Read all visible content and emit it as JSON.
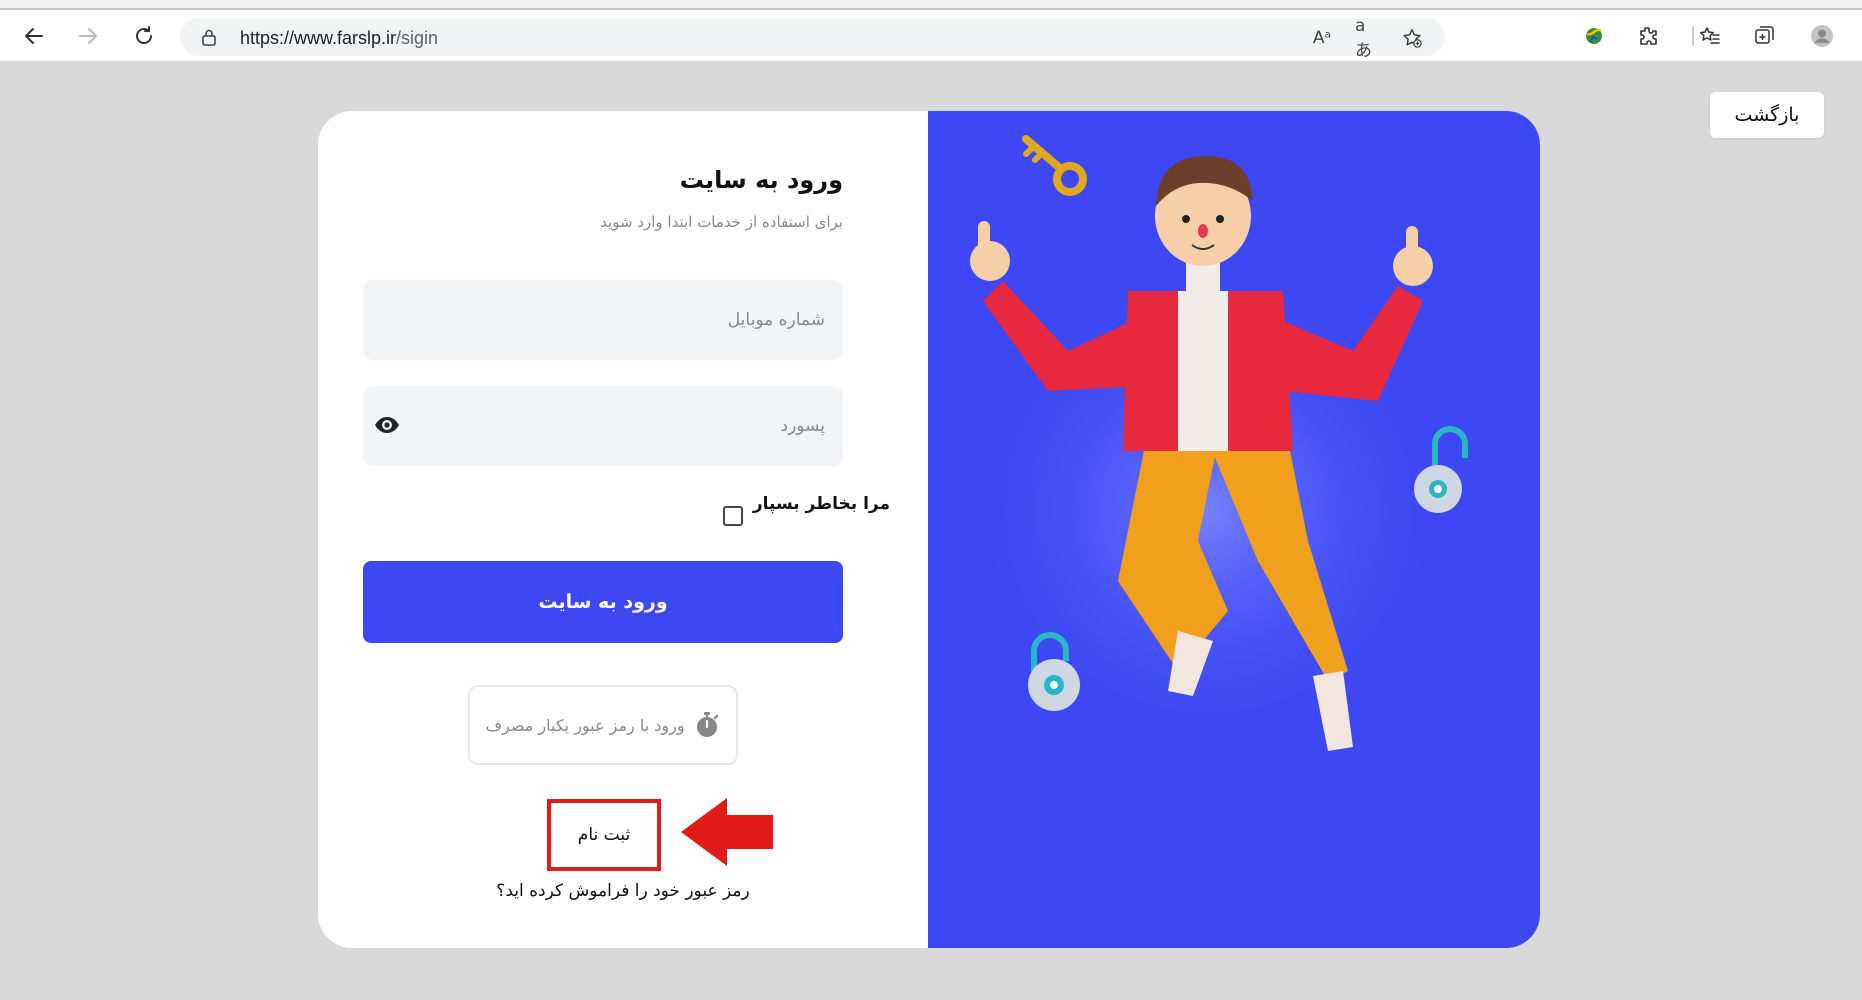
{
  "browser": {
    "url_host": "https://www.farslp.ir",
    "url_path": "/sigin",
    "read_aloud_icon": "Aᵃ",
    "translate_icon": "aあ"
  },
  "page": {
    "back_label": "بازگشت"
  },
  "login": {
    "title": "ورود به سایت",
    "subtitle": "برای استفاده از خدمات ابتدا وارد شوید",
    "mobile_placeholder": "شماره موبایل",
    "password_placeholder": "پسورد",
    "remember_label": "مرا بخاطر بسپار",
    "submit_label": "ورود به سایت",
    "otp_label": "ورود با رمز عبور یکبار مصرف",
    "register_label": "ثبت نام",
    "forgot_label": "رمز عبور خود را فراموش کرده اید؟"
  },
  "colors": {
    "accent": "#3d48f4",
    "highlight": "#e21b1b",
    "field_bg": "#f2f4f8"
  }
}
